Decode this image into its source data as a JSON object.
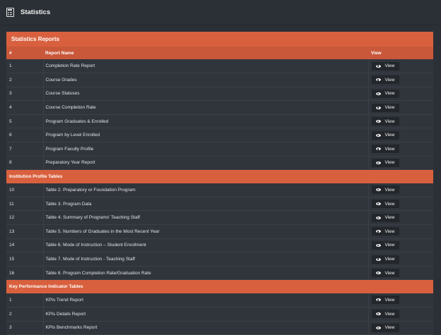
{
  "header": {
    "title": "Statistics"
  },
  "panel": {
    "title": "Statistics Reports"
  },
  "columns": {
    "number": "#",
    "name": "Report Name",
    "view": "View"
  },
  "view_label": "View",
  "sections": [
    {
      "title": "",
      "rows": [
        {
          "num": "1",
          "name": "Completion Rate Report"
        },
        {
          "num": "2",
          "name": "Course Grades"
        },
        {
          "num": "3",
          "name": "Course Statuses"
        },
        {
          "num": "4",
          "name": "Course Completion Rate"
        },
        {
          "num": "5",
          "name": "Program Graduates & Enrolled"
        },
        {
          "num": "6",
          "name": "Program by Level Enrolled"
        },
        {
          "num": "7",
          "name": "Program Faculty Profile"
        },
        {
          "num": "8",
          "name": "Preparatory Year Report"
        }
      ]
    },
    {
      "title": "Institution Profile Tables",
      "rows": [
        {
          "num": "10",
          "name": "Table 2. Preparatory or Foundation Program"
        },
        {
          "num": "11",
          "name": "Table 3. Program Data"
        },
        {
          "num": "12",
          "name": "Table 4. Summary of Programs' Teaching Staff"
        },
        {
          "num": "13",
          "name": "Table 5. Numbers of Graduates in the Most Recent Year"
        },
        {
          "num": "14",
          "name": "Table 6. Mode of Instruction – Student Enrollment"
        },
        {
          "num": "15",
          "name": "Table 7. Mode of Instruction - Teaching Staff"
        },
        {
          "num": "16",
          "name": "Table 8. Program Completion Rate/Graduation Rate"
        }
      ]
    },
    {
      "title": "Key Performance Indicator Tables",
      "rows": [
        {
          "num": "1",
          "name": "KPIs Trend Report"
        },
        {
          "num": "2",
          "name": "KPIs Details Report"
        },
        {
          "num": "3",
          "name": "KPIs Benchmarks Report"
        }
      ]
    }
  ],
  "colors": {
    "accent": "#d9603e",
    "background": "#2b3036",
    "panel": "#30353c"
  },
  "icons": {
    "header": "calculator-icon",
    "view": "eye-icon"
  }
}
